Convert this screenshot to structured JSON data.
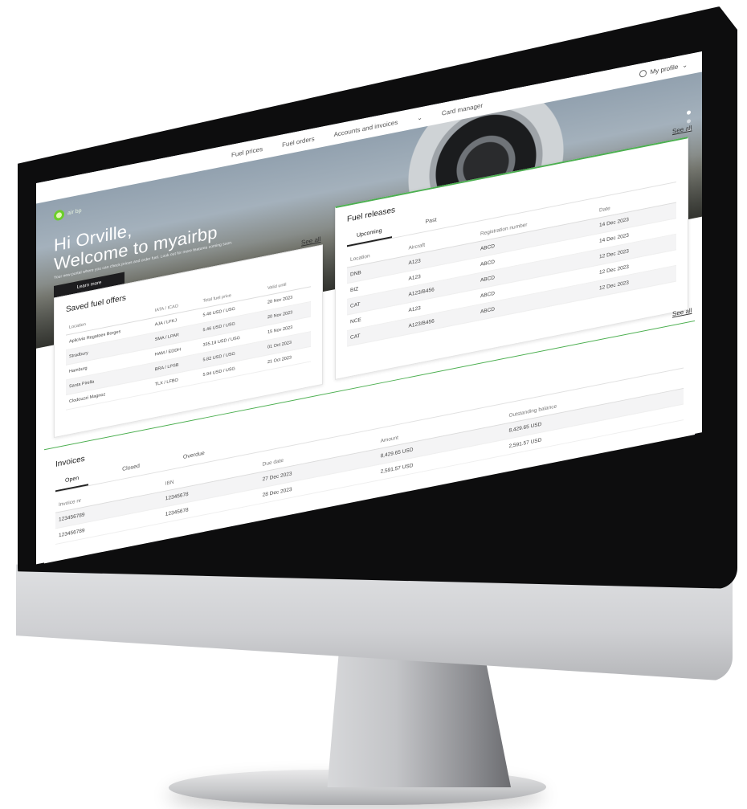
{
  "nav": {
    "items": [
      "Fuel prices",
      "Fuel orders",
      "Accounts and invoices",
      "Card manager"
    ],
    "profile_label": "My profile"
  },
  "logo_text": "air bp",
  "hero": {
    "greeting": "Hi Orville,",
    "welcome": "Welcome to myairbp",
    "subtitle": "Your new portal where you can check prices and order fuel. Look out for more features coming soon.",
    "button_label": "Learn more"
  },
  "see_all_label": "See all",
  "offers": {
    "title": "Saved fuel offers",
    "headers": [
      "Location",
      "IATA / ICAO",
      "Total fuel price",
      "Valid until"
    ],
    "rows": [
      [
        "Aplicivio Regatoes Borges",
        "AJA / LFKJ",
        "5.46 USD / USG",
        "20 Nov 2023"
      ],
      [
        "Stradbury",
        "SMA / LPAR",
        "5.46 USD / USG",
        "20 Nov 2023"
      ],
      [
        "Hamburg",
        "HAM / EDDH",
        "335.19 USD / USG",
        "15 Nov 2023"
      ],
      [
        "Santa Pirella",
        "BRA / LPSB",
        "5.82 USD / USG",
        "01 Oct 2023"
      ],
      [
        "Clodouzzi Magnoz",
        "TLX / LFBO",
        "5.94 USD / USG",
        "21 Oct 2023"
      ]
    ]
  },
  "releases": {
    "title": "Fuel releases",
    "tabs": [
      "Upcoming",
      "Past"
    ],
    "headers": [
      "Location",
      "Aircraft",
      "Registration number",
      "Date"
    ],
    "rows": [
      [
        "DNB",
        "A123",
        "ABCD",
        "14 Dec 2023"
      ],
      [
        "BIZ",
        "A123",
        "ABCD",
        "14 Dec 2023"
      ],
      [
        "CAT",
        "A123/B456",
        "ABCD",
        "12 Dec 2023"
      ],
      [
        "NCE",
        "A123",
        "ABCD",
        "12 Dec 2023"
      ],
      [
        "CAT",
        "A123/B456",
        "ABCD",
        "12 Dec 2023"
      ]
    ]
  },
  "invoices": {
    "title": "Invoices",
    "tabs": [
      "Open",
      "Closed",
      "Overdue"
    ],
    "headers": [
      "Invoice nr",
      "IBN",
      "Due date",
      "Amount",
      "Outstanding balance"
    ],
    "rows": [
      [
        "123456789",
        "12345678",
        "27 Dec 2023",
        "8,429.65 USD",
        "8,429.65 USD"
      ],
      [
        "123456789",
        "12345678",
        "28 Dec 2023",
        "2,591.57 USD",
        "2,591.57 USD"
      ]
    ]
  }
}
